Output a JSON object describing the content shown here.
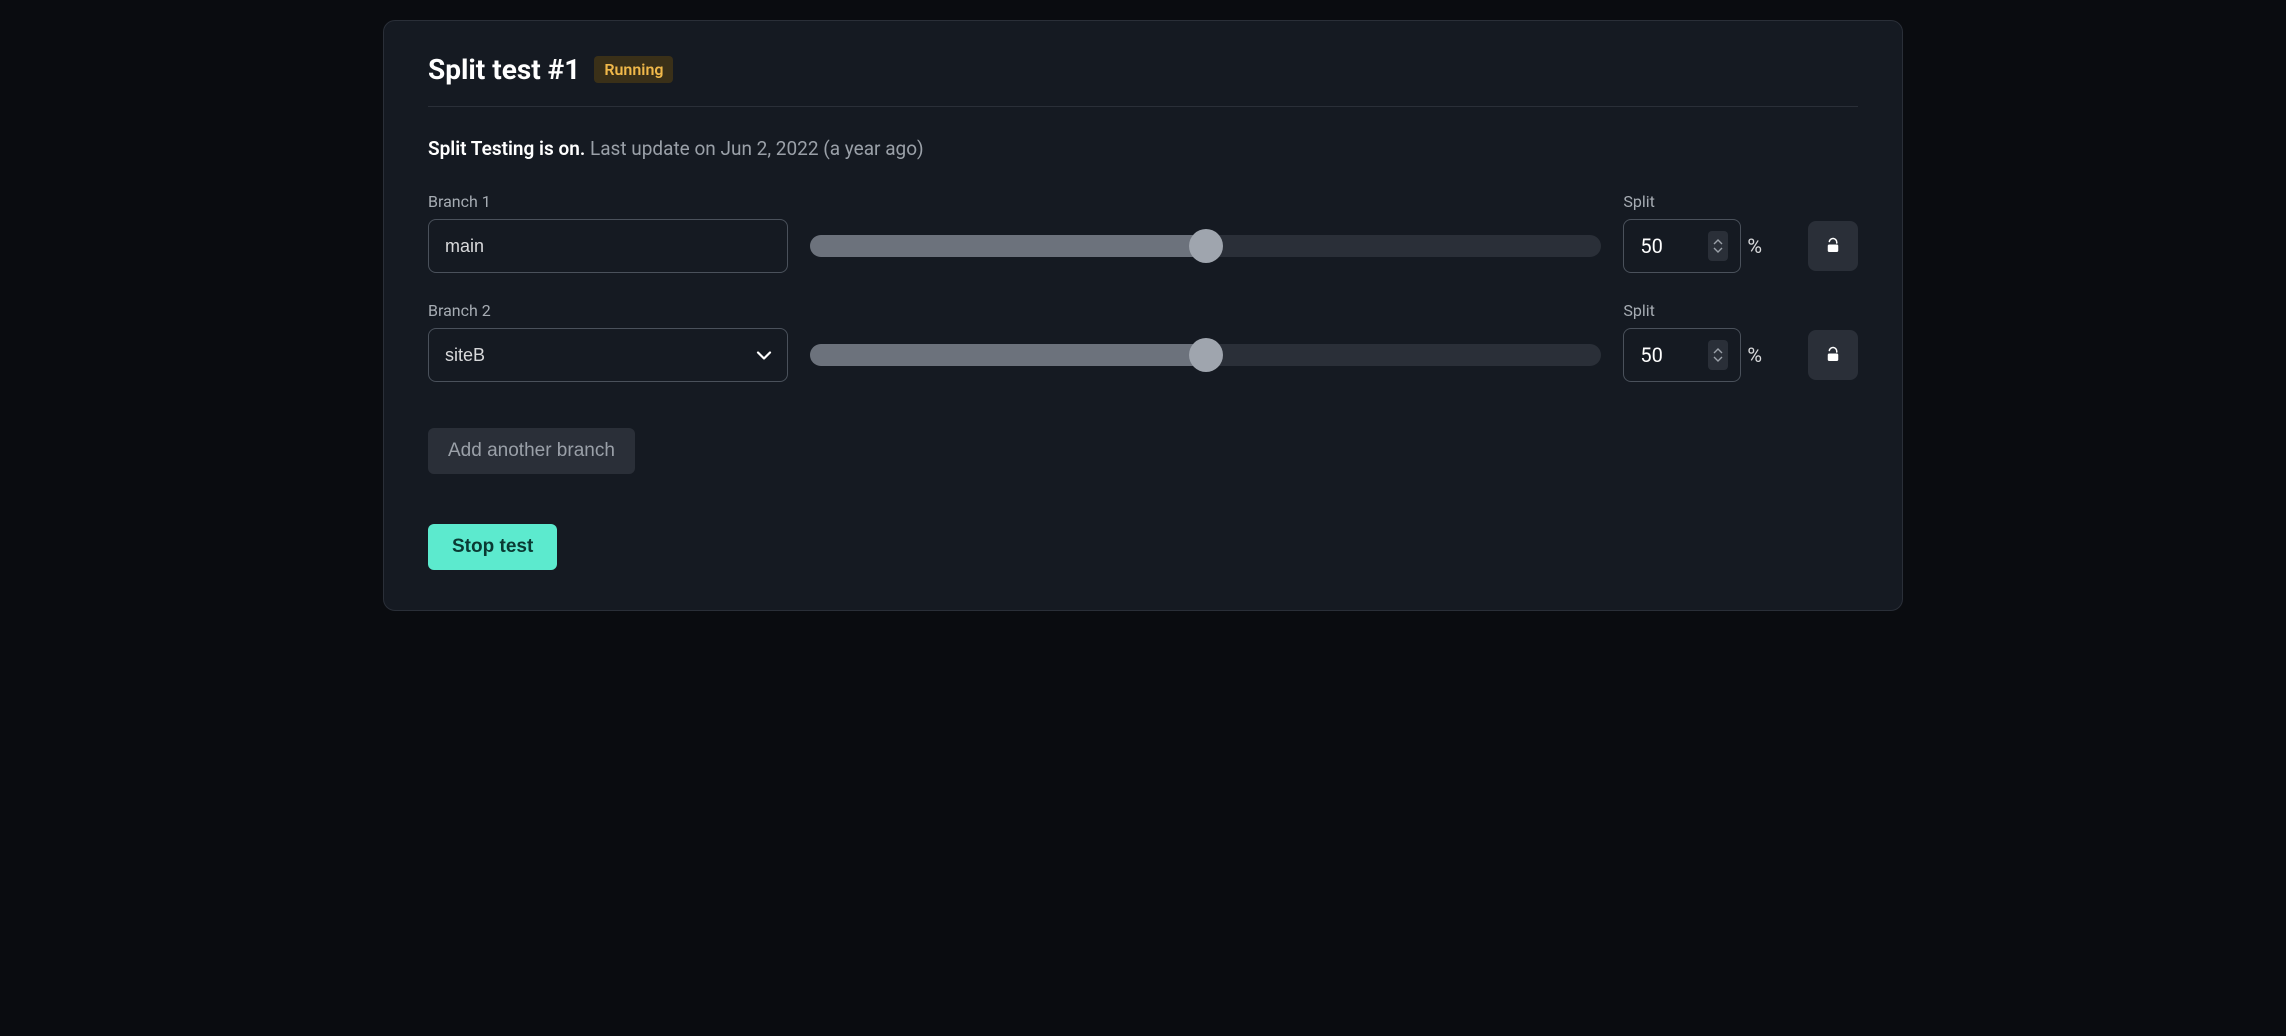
{
  "header": {
    "title": "Split test #1",
    "badge": "Running"
  },
  "status": {
    "strong": "Split Testing is on.",
    "muted": "Last update on Jun 2, 2022 (a year ago)"
  },
  "branches": [
    {
      "label": "Branch 1",
      "name": "main",
      "is_select": false,
      "split_label": "Split",
      "split_value": "50",
      "percent_symbol": "%",
      "slider_percent": 50
    },
    {
      "label": "Branch 2",
      "name": "siteB",
      "is_select": true,
      "split_label": "Split",
      "split_value": "50",
      "percent_symbol": "%",
      "slider_percent": 50
    }
  ],
  "buttons": {
    "add_branch": "Add another branch",
    "stop_test": "Stop test"
  }
}
